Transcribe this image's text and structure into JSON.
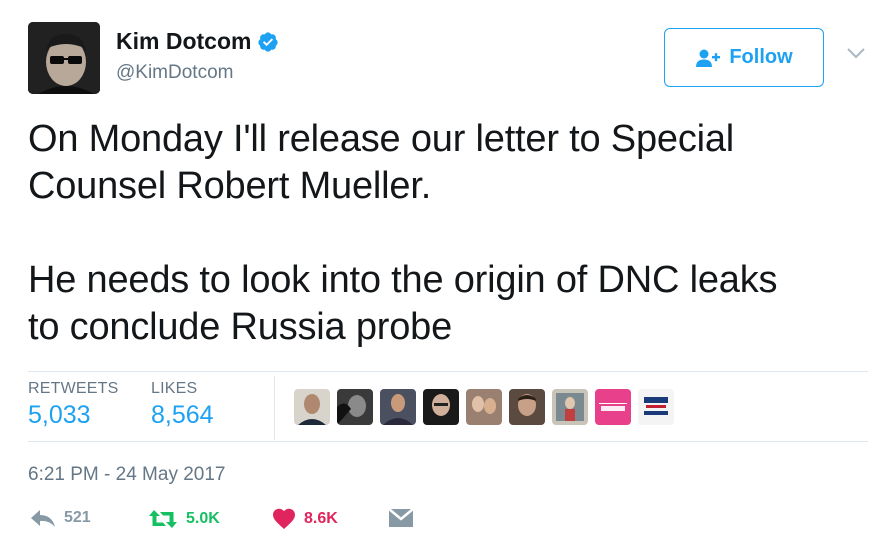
{
  "user": {
    "display_name": "Kim Dotcom",
    "handle": "@KimDotcom",
    "verified": true
  },
  "follow_button": {
    "label": "Follow",
    "icon": "add-user-icon"
  },
  "tweet": {
    "text": "On Monday I'll release our letter to Special\nCounsel Robert Mueller.\n\nHe needs to look into the origin of DNC leaks\nto conclude Russia probe"
  },
  "stats": {
    "retweets_label": "RETWEETS",
    "retweets_value": "5,033",
    "likes_label": "LIKES",
    "likes_value": "8,564"
  },
  "likers": [
    "liker-avatar-1",
    "liker-avatar-2",
    "liker-avatar-3",
    "liker-avatar-4",
    "liker-avatar-5",
    "liker-avatar-6",
    "liker-avatar-7",
    "liker-avatar-8",
    "liker-avatar-9"
  ],
  "liker_badges": {
    "badge_8_text": "WOMEN TRUMP",
    "badge_9_text": "TRUMP WITH BALLS"
  },
  "timestamp": "6:21 PM - 24 May 2017",
  "actions": {
    "reply_count": "521",
    "retweet_count": "5.0K",
    "like_count": "8.6K"
  },
  "colors": {
    "accent": "#1da1f2",
    "retweet": "#17bf63",
    "like": "#e0245e",
    "muted": "#657786"
  }
}
